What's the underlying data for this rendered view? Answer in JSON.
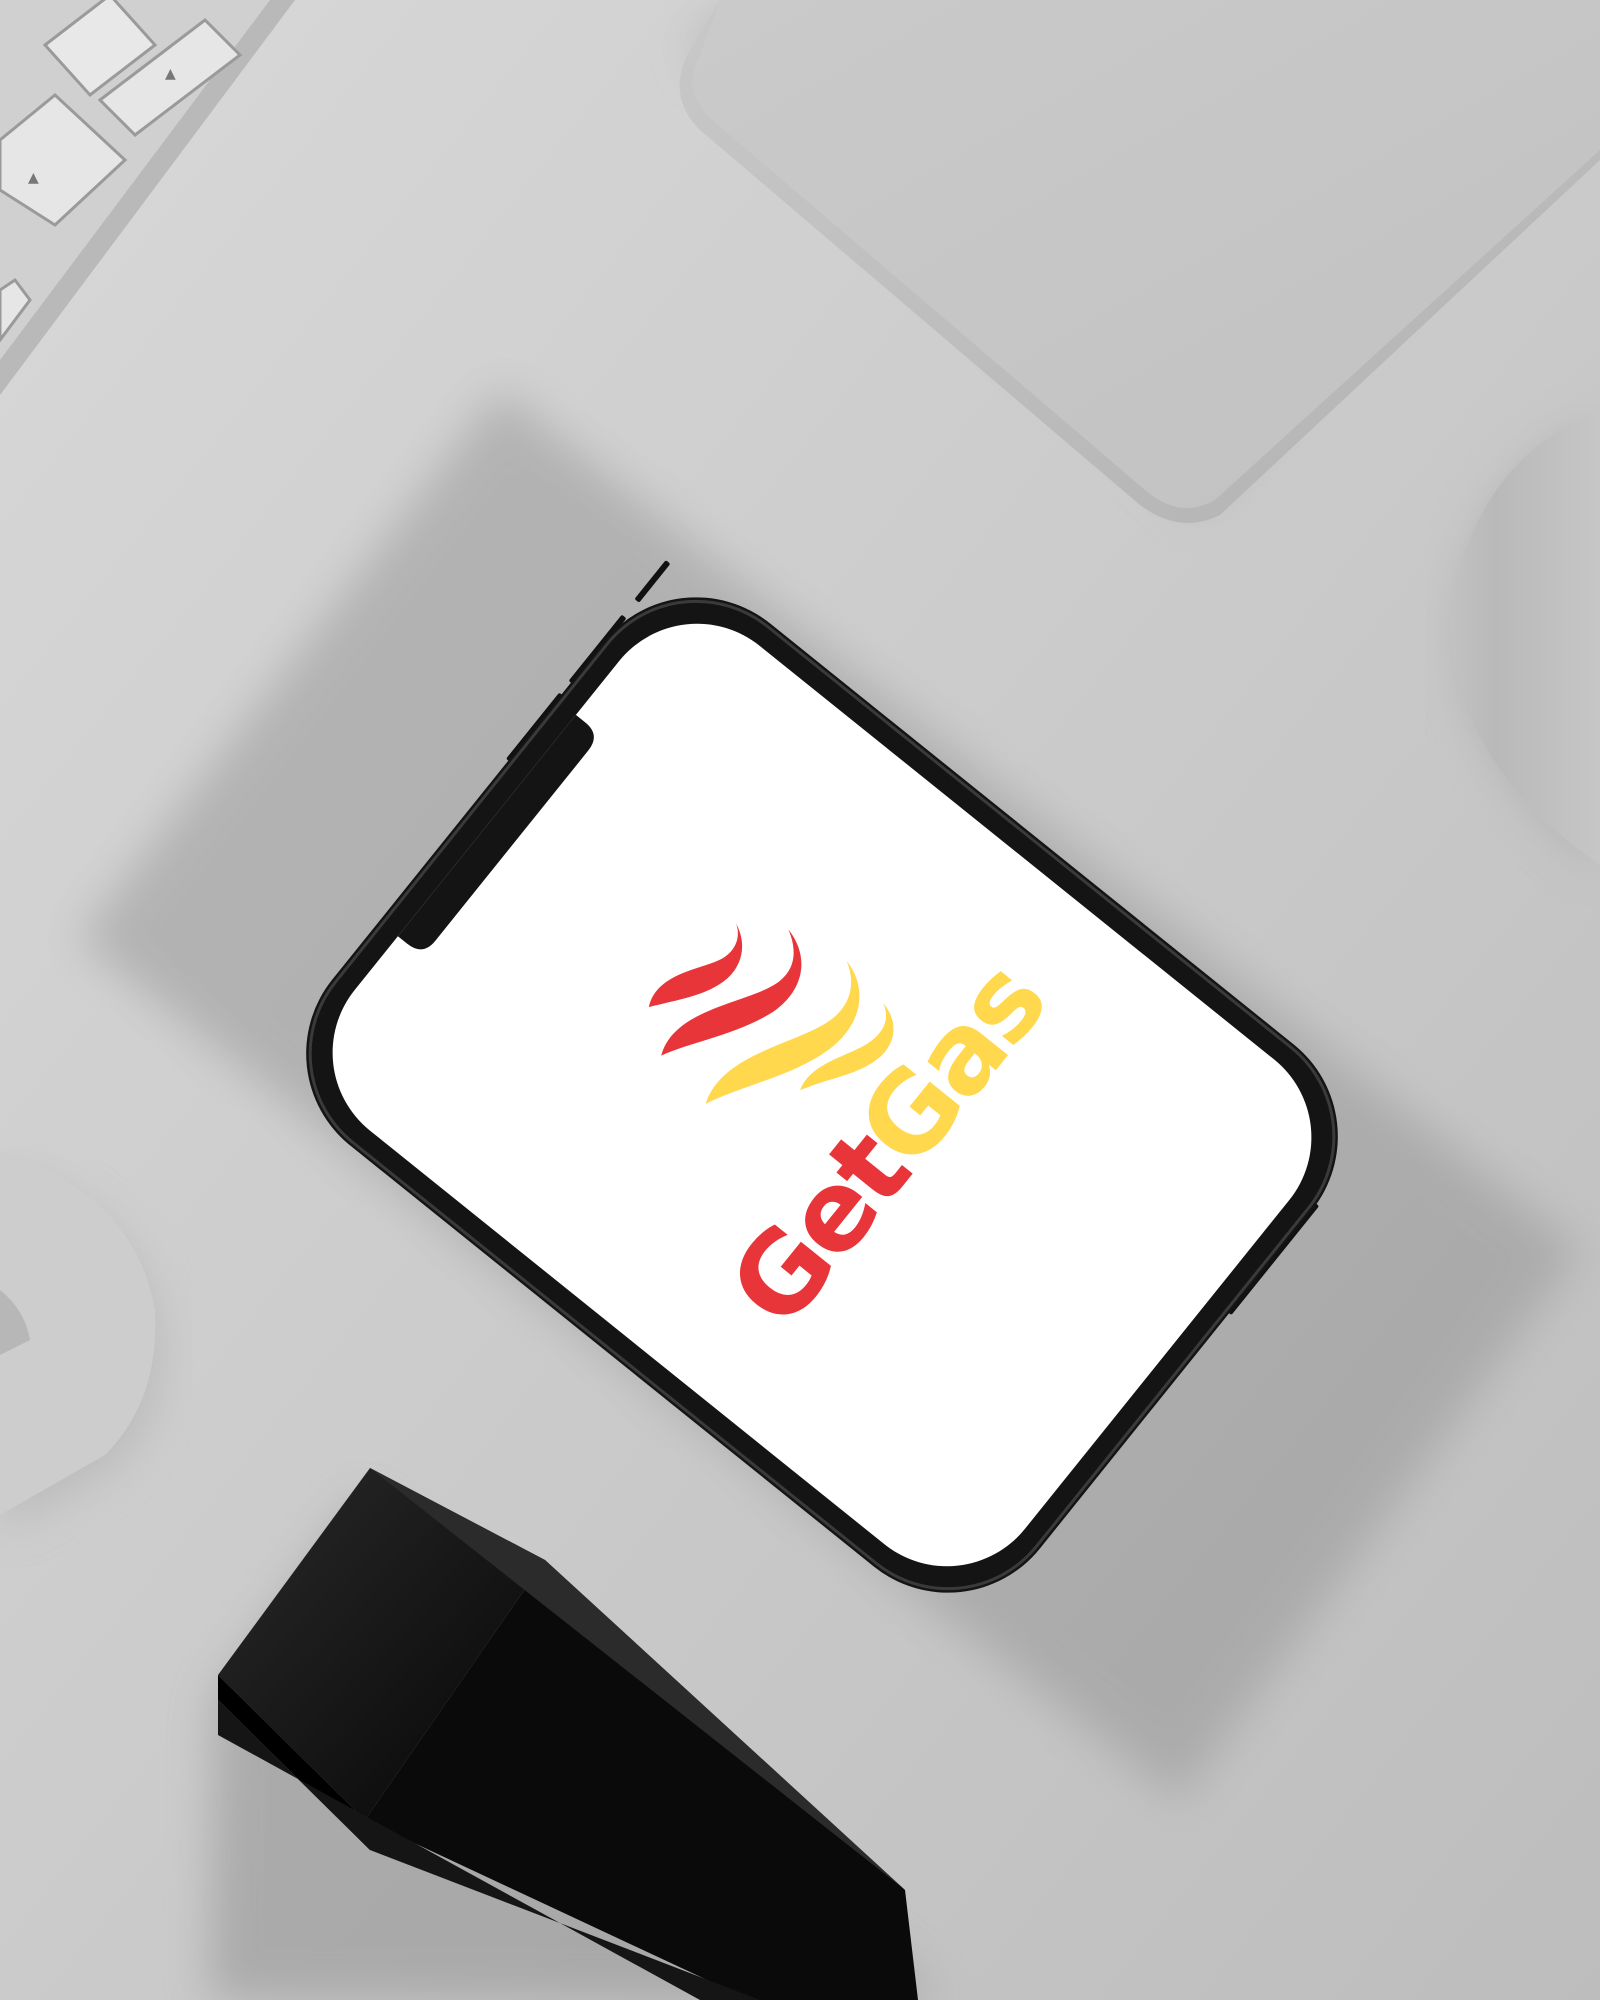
{
  "app": {
    "name": "GetGas",
    "wordmark": {
      "part1": "Get",
      "part2": "Gas"
    }
  },
  "scene": {
    "description_objects": [
      "keyboard",
      "phone",
      "power-bank",
      "airpods-case",
      "mouse",
      "black-block"
    ]
  },
  "colors": {
    "desk": "#c9c9c9",
    "brand_red": "#e8353a",
    "brand_yellow": "#ffd84d",
    "phone_frame": "#141414",
    "screen": "#ffffff",
    "block": "#0e0e0e"
  },
  "icons": {
    "logo": "flame-icon"
  }
}
